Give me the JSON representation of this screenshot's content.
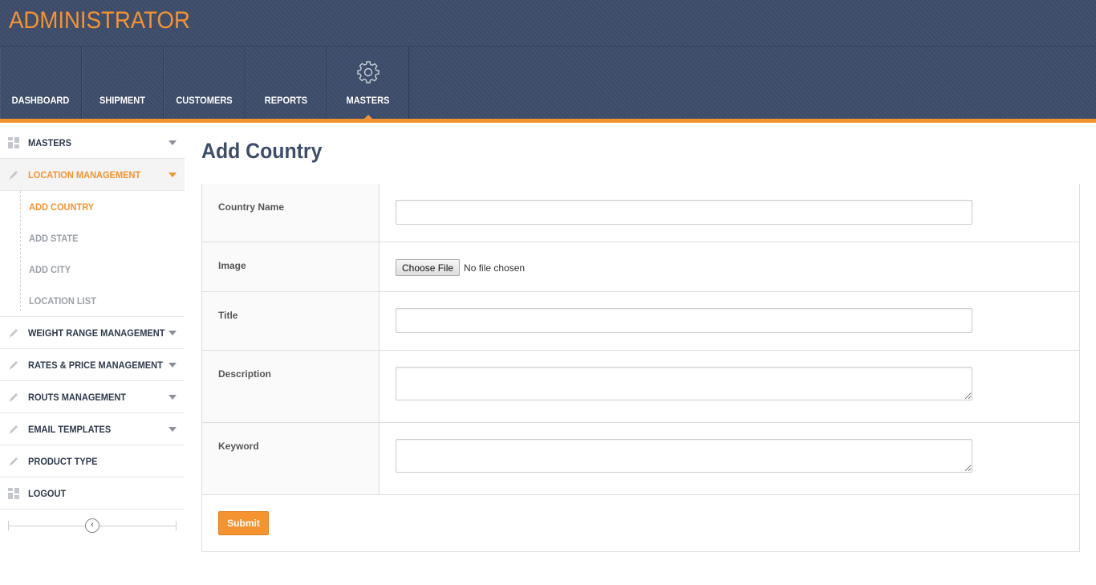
{
  "header": {
    "brand": "ADMINISTRATOR"
  },
  "nav": {
    "items": [
      {
        "label": "DASHBOARD"
      },
      {
        "label": "SHIPMENT"
      },
      {
        "label": "CUSTOMERS"
      },
      {
        "label": "REPORTS"
      },
      {
        "label": "MASTERS",
        "icon": "gear-icon",
        "active": true
      }
    ]
  },
  "sidebar": {
    "items": [
      {
        "label": "MASTERS",
        "icon": "grid-icon"
      },
      {
        "label": "LOCATION MANAGEMENT",
        "icon": "pencil-icon",
        "open": true
      },
      {
        "label": "WEIGHT RANGE MANAGEMENT",
        "icon": "pencil-icon"
      },
      {
        "label": "RATES & PRICE MANAGEMENT",
        "icon": "pencil-icon"
      },
      {
        "label": "ROUTS MANAGEMENT",
        "icon": "pencil-icon"
      },
      {
        "label": "EMAIL TEMPLATES",
        "icon": "pencil-icon"
      },
      {
        "label": "PRODUCT TYPE",
        "icon": "pencil-icon"
      },
      {
        "label": "LOGOUT",
        "icon": "grid-icon"
      }
    ],
    "submenu": [
      {
        "label": "ADD COUNTRY",
        "current": true
      },
      {
        "label": "ADD STATE"
      },
      {
        "label": "ADD CITY"
      },
      {
        "label": "LOCATION LIST"
      }
    ],
    "collapse_glyph": "‹"
  },
  "main": {
    "title": "Add Country",
    "fields": {
      "country_name": {
        "label": "Country Name",
        "value": ""
      },
      "image": {
        "label": "Image",
        "button": "Choose File",
        "status": "No file chosen"
      },
      "title": {
        "label": "Title",
        "value": ""
      },
      "description": {
        "label": "Description",
        "value": ""
      },
      "keyword": {
        "label": "Keyword",
        "value": ""
      }
    },
    "submit_label": "Submit"
  },
  "colors": {
    "accent": "#f59331",
    "header_bg": "#3d4d6a",
    "title": "#3d4d6a"
  }
}
